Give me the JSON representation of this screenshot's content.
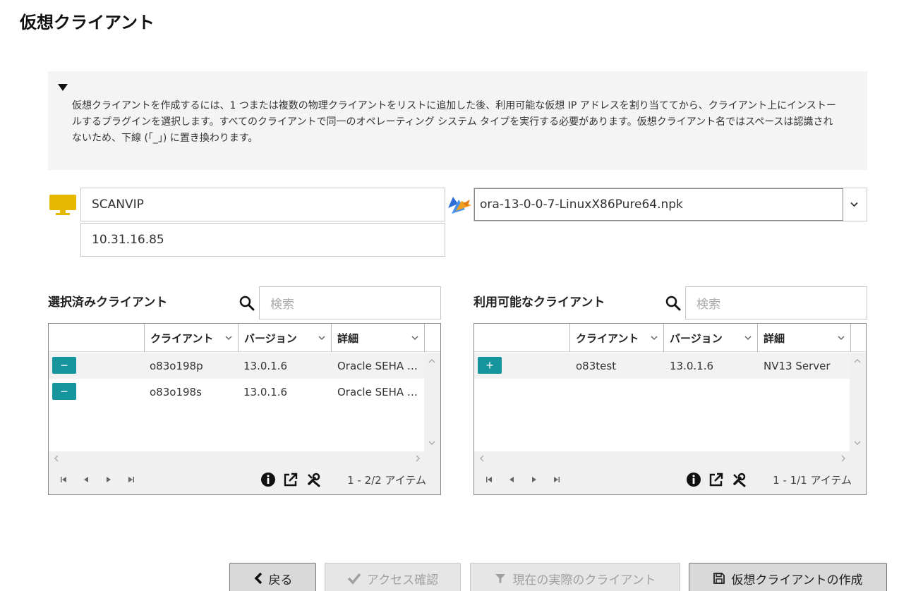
{
  "page": {
    "title": "仮想クライアント"
  },
  "info": {
    "text": "仮想クライアントを作成するには、1 つまたは複数の物理クライアントをリストに追加した後、利用可能な仮想 IP アドレスを割り当ててから、クライアント上にインストールするプラグインを選択します。すべてのクライアントで同一のオペレーティング システム タイプを実行する必要があります。仮想クライアント名ではスペースは認識されないため、下線 (「_」) に置き換わります。"
  },
  "client": {
    "name": "SCANVIP",
    "ip": "10.31.16.85"
  },
  "plugin": {
    "selected": "ora-13-0-0-7-LinuxX86Pure64.npk"
  },
  "selected_clients": {
    "title": "選択済みクライアント",
    "search_placeholder": "検索",
    "columns": [
      "クライアント",
      "バージョン",
      "詳細"
    ],
    "rows": [
      {
        "action": "−",
        "client": "o83o198p",
        "version": "13.0.1.6",
        "detail": "Oracle SEHA …"
      },
      {
        "action": "−",
        "client": "o83o198s",
        "version": "13.0.1.6",
        "detail": "Oracle SEHA …"
      }
    ],
    "count": "1 - 2/2 アイテム"
  },
  "available_clients": {
    "title": "利用可能なクライアント",
    "search_placeholder": "検索",
    "columns": [
      "クライアント",
      "バージョン",
      "詳細"
    ],
    "rows": [
      {
        "action": "+",
        "client": "o83test",
        "version": "13.0.1.6",
        "detail": "NV13 Server"
      }
    ],
    "count": "1 - 1/1 アイテム"
  },
  "footer": {
    "back": "戻る",
    "check_access": "アクセス確認",
    "actual_clients": "現在の実際のクライアント",
    "create": "仮想クライアントの作成"
  },
  "colors": {
    "accent": "#16959e",
    "monitor": "#e6b800"
  }
}
